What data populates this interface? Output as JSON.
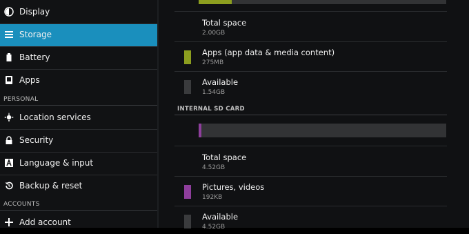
{
  "sidebar": {
    "items": [
      {
        "label": "Display",
        "icon": "brightness-icon"
      },
      {
        "label": "Storage",
        "icon": "storage-icon",
        "selected": true
      },
      {
        "label": "Battery",
        "icon": "battery-icon"
      },
      {
        "label": "Apps",
        "icon": "apps-icon"
      },
      {
        "label": "Location services",
        "icon": "location-icon"
      },
      {
        "label": "Security",
        "icon": "lock-icon"
      },
      {
        "label": "Language & input",
        "icon": "keyboard-icon"
      },
      {
        "label": "Backup & reset",
        "icon": "restore-icon"
      },
      {
        "label": "Add account",
        "icon": "plus-icon"
      }
    ],
    "sections": {
      "personal": "PERSONAL",
      "accounts": "ACCOUNTS"
    }
  },
  "storage": {
    "device": {
      "usage_fraction": 0.134,
      "total": {
        "title": "Total space",
        "value": "2.00GB"
      },
      "apps": {
        "title": "Apps (app data & media content)",
        "value": "275MB"
      },
      "available": {
        "title": "Available",
        "value": "1.54GB"
      }
    },
    "sd_card": {
      "header": "INTERNAL SD CARD",
      "usage_fraction": 0.012,
      "total": {
        "title": "Total space",
        "value": "4.52GB"
      },
      "pictures": {
        "title": "Pictures, videos",
        "value": "192KB"
      },
      "available": {
        "title": "Available",
        "value": "4.52GB"
      }
    }
  },
  "colors": {
    "selected": "#1a8fbd",
    "apps": "#8c9e1f",
    "pictures": "#8e3e9c",
    "available": "#3a3b3d"
  }
}
